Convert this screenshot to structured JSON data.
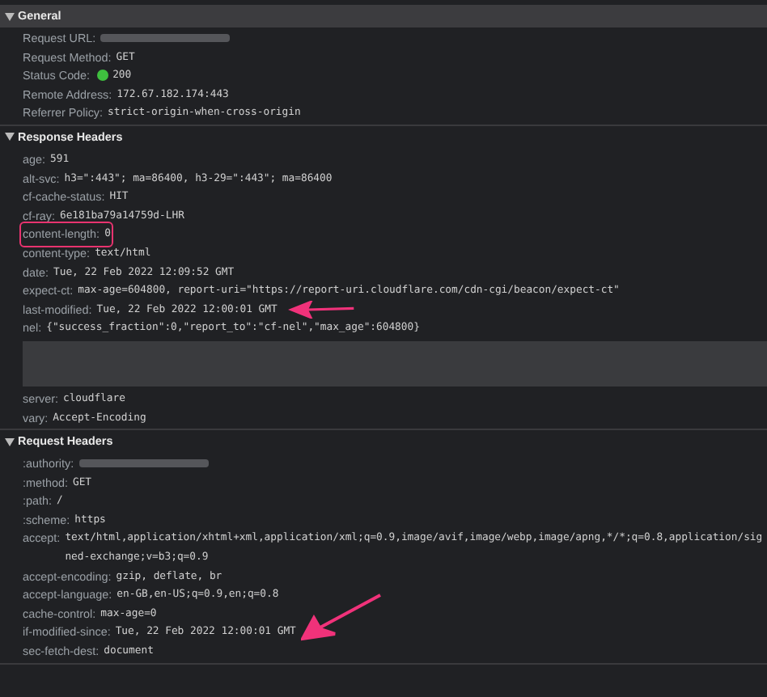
{
  "sections": [
    {
      "title": "General",
      "expanded": true,
      "selected": true,
      "rows": [
        {
          "kind": "redacted",
          "name": "Request URL:"
        },
        {
          "kind": "text",
          "name": "Request Method:",
          "value": "GET"
        },
        {
          "kind": "status",
          "name": "Status Code:",
          "value": "200",
          "color": "#3fbf3f"
        },
        {
          "kind": "text",
          "name": "Remote Address:",
          "value": "172.67.182.174:443"
        },
        {
          "kind": "text",
          "name": "Referrer Policy:",
          "value": "strict-origin-when-cross-origin"
        }
      ]
    },
    {
      "title": "Response Headers",
      "expanded": true,
      "selected": false,
      "rows": [
        {
          "kind": "text",
          "name": "age:",
          "value": "591"
        },
        {
          "kind": "text",
          "name": "alt-svc:",
          "value": "h3=\":443\"; ma=86400, h3-29=\":443\"; ma=86400"
        },
        {
          "kind": "text",
          "name": "cf-cache-status:",
          "value": "HIT"
        },
        {
          "kind": "text",
          "name": "cf-ray:",
          "value": "6e181ba79a14759d-LHR"
        },
        {
          "kind": "boxed-text",
          "name": "content-length:",
          "value": "0"
        },
        {
          "kind": "text",
          "name": "content-type:",
          "value": "text/html"
        },
        {
          "kind": "text",
          "name": "date:",
          "value": "Tue, 22 Feb 2022 12:09:52 GMT"
        },
        {
          "kind": "text",
          "name": "expect-ct:",
          "value": "max-age=604800, report-uri=\"https://report-uri.cloudflare.com/cdn-cgi/beacon/expect-ct\""
        },
        {
          "kind": "arrowed-text",
          "name": "last-modified:",
          "value": "Tue, 22 Feb 2022 12:00:01 GMT"
        },
        {
          "kind": "text",
          "name": "nel:",
          "value": "{\"success_fraction\":0,\"report_to\":\"cf-nel\",\"max_age\":604800}"
        },
        {
          "kind": "redacted-block"
        },
        {
          "kind": "text",
          "name": "server:",
          "value": "cloudflare"
        },
        {
          "kind": "text",
          "name": "vary:",
          "value": "Accept-Encoding"
        }
      ]
    },
    {
      "title": "Request Headers",
      "expanded": true,
      "selected": false,
      "rows": [
        {
          "kind": "redacted",
          "name": ":authority:"
        },
        {
          "kind": "text",
          "name": ":method:",
          "value": "GET"
        },
        {
          "kind": "text",
          "name": ":path:",
          "value": "/"
        },
        {
          "kind": "text",
          "name": ":scheme:",
          "value": "https"
        },
        {
          "kind": "text",
          "name": "accept:",
          "value": "text/html,application/xhtml+xml,application/xml;q=0.9,image/avif,image/webp,image/apng,*/*;q=0.8,application/signed-exchange;v=b3;q=0.9"
        },
        {
          "kind": "text",
          "name": "accept-encoding:",
          "value": "gzip, deflate, br"
        },
        {
          "kind": "text",
          "name": "accept-language:",
          "value": "en-GB,en-US;q=0.9,en;q=0.8"
        },
        {
          "kind": "text",
          "name": "cache-control:",
          "value": "max-age=0"
        },
        {
          "kind": "diagonal-arrowed-text",
          "name": "if-modified-since:",
          "value": "Tue, 22 Feb 2022 12:00:01 GMT"
        },
        {
          "kind": "text",
          "name": "sec-fetch-dest:",
          "value": "document"
        }
      ]
    }
  ]
}
